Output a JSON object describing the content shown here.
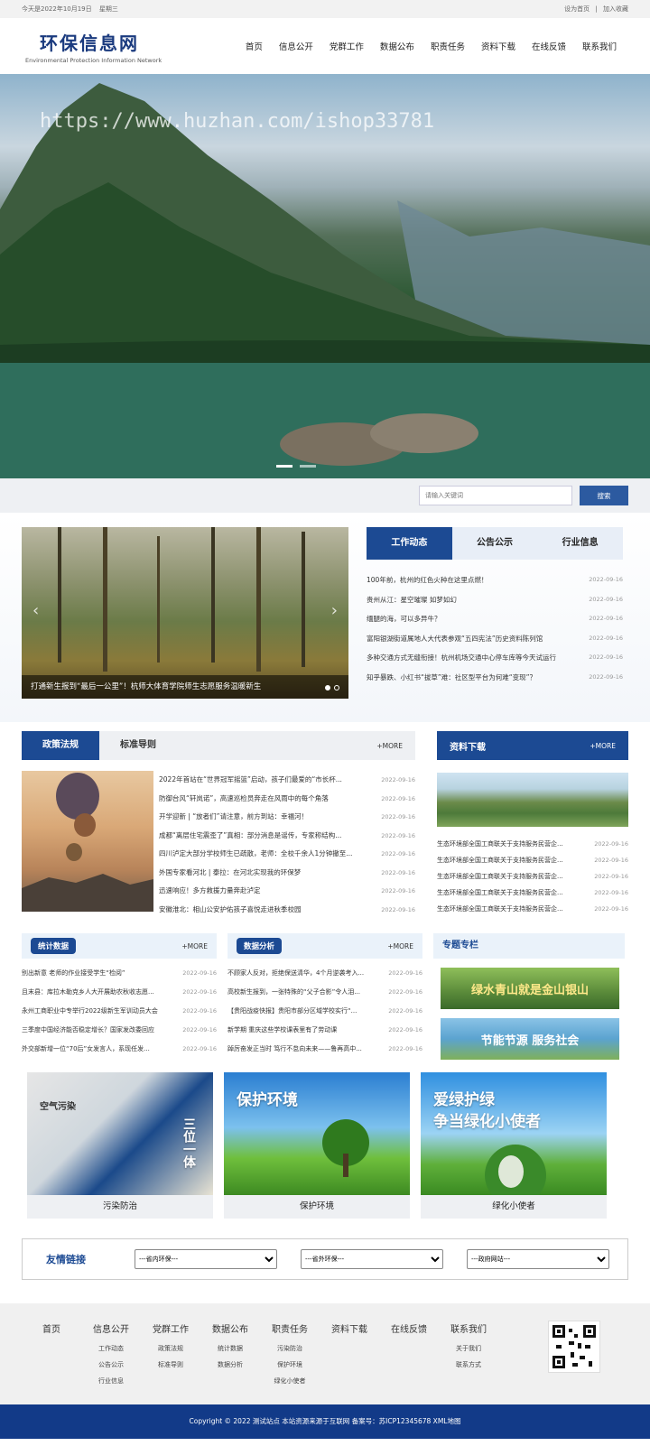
{
  "topbar": {
    "date": "今天是2022年10月19日",
    "weekday": "星期三",
    "set_home": "设为首页",
    "sep": "|",
    "add_fav": "加入收藏"
  },
  "logo": {
    "cn": "环保信息网",
    "en": "Environmental Protection Information Network"
  },
  "nav": [
    "首页",
    "信息公开",
    "党群工作",
    "数据公布",
    "职责任务",
    "资料下载",
    "在线反馈",
    "联系我们"
  ],
  "banner": {
    "watermark": "https://www.huzhan.com/ishop33781"
  },
  "search": {
    "placeholder": "请输入关键词",
    "button": "搜索"
  },
  "slider": {
    "caption": "打通新生报到“最后一公里”！杭师大体育学院师生志愿服务温暖新生",
    "prev": "‹",
    "next": "›"
  },
  "tabs": [
    "工作动态",
    "公告公示",
    "行业信息"
  ],
  "news": [
    {
      "title": "100年前，杭州的红色火种在这里点燃！",
      "date": "2022-09-16"
    },
    {
      "title": "贵州从江：星空璀璨 如梦如幻",
      "date": "2022-09-16"
    },
    {
      "title": "缅腿的海，可以多异牛？",
      "date": "2022-09-16"
    },
    {
      "title": "富阳银湖街道属地人大代表参观“五四宪法”历史资料陈列馆",
      "date": "2022-09-16"
    },
    {
      "title": "多种交通方式无缝衔接！杭州机场交通中心停车库等今天试运行",
      "date": "2022-09-16"
    },
    {
      "title": "知乎暴跌、小红书“拔草”难：社区型平台为何难“变现”？",
      "date": "2022-09-16"
    }
  ],
  "policy": {
    "tabs": [
      "政策法规",
      "标准导则"
    ],
    "more": "+MORE",
    "items": [
      {
        "title": "2022年首站在“世界冠军摇篮”启动，孩子们最爱的“市长杯...",
        "date": "2022-09-16"
      },
      {
        "title": "防御台风“轩岚诺”，高速巡检员奔走在风雨中的每个角落",
        "date": "2022-09-16"
      },
      {
        "title": "开学迎新 | “放者们”请注意，前方到站：幸福河！",
        "date": "2022-09-16"
      },
      {
        "title": "成都“离层住宅震歪了”真相：部分消息是谣传，专家称结构...",
        "date": "2022-09-16"
      },
      {
        "title": "四川泸定大部分学校师生已疏散，老师：全校千余人1分钟撤至...",
        "date": "2022-09-16"
      },
      {
        "title": "外国专家看河北 | 泰拉：在河北实现我的环保梦",
        "date": "2022-09-16"
      },
      {
        "title": "迅速响应！多方救援力量奔赴泸定",
        "date": "2022-09-16"
      },
      {
        "title": "安徽淮北：相山公安护佑孩子喜悦走进秋季校园",
        "date": "2022-09-16"
      }
    ]
  },
  "download": {
    "title": "资料下载",
    "more": "+MORE",
    "items": [
      {
        "title": "生态环境部全国工商联关于支持服务民营企...",
        "date": "2022-09-16"
      },
      {
        "title": "生态环境部全国工商联关于支持服务民营企...",
        "date": "2022-09-16"
      },
      {
        "title": "生态环境部全国工商联关于支持服务民营企...",
        "date": "2022-09-16"
      },
      {
        "title": "生态环境部全国工商联关于支持服务民营企...",
        "date": "2022-09-16"
      },
      {
        "title": "生态环境部全国工商联关于支持服务民营企...",
        "date": "2022-09-16"
      }
    ]
  },
  "stats": {
    "title": "统计数据",
    "more": "+MORE",
    "items": [
      {
        "title": "别出新意 老师的作业接受学生“检阅”",
        "date": "2022-09-16"
      },
      {
        "title": "且末县：库拉木勒克乡人大开展助农秋收志愿...",
        "date": "2022-09-16"
      },
      {
        "title": "永州工商职业中专举行2022级新生军训动员大会",
        "date": "2022-09-16"
      },
      {
        "title": "三季度中国经济能否稳定增长？国家发改委回应",
        "date": "2022-09-16"
      },
      {
        "title": "外交部新增一位“70后”女发言人，系现任发...",
        "date": "2022-09-16"
      }
    ]
  },
  "analysis": {
    "title": "数据分析",
    "more": "+MORE",
    "items": [
      {
        "title": "不顾家人反对，拒绝保送清华，4个月逆袭考入...",
        "date": "2022-09-16"
      },
      {
        "title": "高校新生报到，一张特殊的“父子合影”令人泪...",
        "date": "2022-09-16"
      },
      {
        "title": "【贵阳战疫快报】贵阳市部分区域学校实行“...",
        "date": "2022-09-16"
      },
      {
        "title": "新学期 重庆这些学校课表里有了劳动课",
        "date": "2022-09-16"
      },
      {
        "title": "踔厉奋发正当时 笃行不怠向未来——鲁再高中...",
        "date": "2022-09-16"
      }
    ]
  },
  "special": {
    "title": "专题专栏",
    "banner1": "绿水青山就是金山银山",
    "banner2": "节能节源 服务社会"
  },
  "cards": [
    {
      "image_text_1": "空气污染",
      "image_text_2": "三位一体",
      "caption": "污染防治"
    },
    {
      "image_text_1": "保护环境",
      "image_text_2": "",
      "caption": "保护环境"
    },
    {
      "image_text_1": "爱绿护绿",
      "image_text_2": "争当绿化小使者",
      "caption": "绿化小使者"
    }
  ],
  "friend_links": {
    "title": "友情链接",
    "selects": [
      "---省内环保---",
      "---省外环保---",
      "---政府网站---"
    ]
  },
  "footer": {
    "cols": [
      {
        "head": "首页",
        "subs": []
      },
      {
        "head": "信息公开",
        "subs": [
          "工作动态",
          "公告公示",
          "行业信息"
        ]
      },
      {
        "head": "党群工作",
        "subs": [
          "政策法规",
          "标准导则"
        ]
      },
      {
        "head": "数据公布",
        "subs": [
          "统计数据",
          "数据分析"
        ]
      },
      {
        "head": "职责任务",
        "subs": [
          "污染防治",
          "保护环境",
          "绿化小使者"
        ]
      },
      {
        "head": "资料下载",
        "subs": []
      },
      {
        "head": "在线反馈",
        "subs": []
      },
      {
        "head": "联系我们",
        "subs": [
          "关于我们",
          "联系方式"
        ]
      }
    ],
    "copyright": "Copyright © 2022 测试站点 本站资源来源于互联网 备案号：苏ICP12345678 XML地图"
  },
  "colors": {
    "primary": "#1c4a93",
    "footer_bar": "#123a88"
  }
}
